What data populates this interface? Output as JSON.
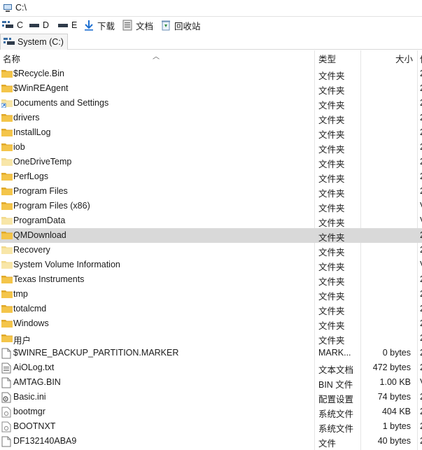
{
  "path_bar": {
    "path": "C:\\"
  },
  "drives": [
    {
      "label": "C",
      "icon": "drive-icon"
    },
    {
      "label": "D",
      "icon": "drive-icon"
    },
    {
      "label": "E",
      "icon": "drive-icon"
    },
    {
      "label": "下载",
      "icon": "download-arrow-icon"
    },
    {
      "label": "文档",
      "icon": "document-icon"
    },
    {
      "label": "回收站",
      "icon": "recycle-bin-icon"
    }
  ],
  "tab": {
    "label": "System (C:)"
  },
  "columns": {
    "name": "名称",
    "type": "类型",
    "size": "大小",
    "date": "修"
  },
  "rows": [
    {
      "name": "$Recycle.Bin",
      "type": "文件夹",
      "size": "",
      "date": "2",
      "kind": "folder"
    },
    {
      "name": "$WinREAgent",
      "type": "文件夹",
      "size": "",
      "date": "2",
      "kind": "folder"
    },
    {
      "name": "Documents and Settings",
      "type": "文件夹",
      "size": "",
      "date": "2",
      "kind": "link"
    },
    {
      "name": "drivers",
      "type": "文件夹",
      "size": "",
      "date": "2",
      "kind": "folder"
    },
    {
      "name": "InstallLog",
      "type": "文件夹",
      "size": "",
      "date": "2",
      "kind": "folder"
    },
    {
      "name": "iob",
      "type": "文件夹",
      "size": "",
      "date": "2",
      "kind": "folder"
    },
    {
      "name": "OneDriveTemp",
      "type": "文件夹",
      "size": "",
      "date": "2",
      "kind": "folder-light"
    },
    {
      "name": "PerfLogs",
      "type": "文件夹",
      "size": "",
      "date": "2",
      "kind": "folder"
    },
    {
      "name": "Program Files",
      "type": "文件夹",
      "size": "",
      "date": "2",
      "kind": "folder"
    },
    {
      "name": "Program Files (x86)",
      "type": "文件夹",
      "size": "",
      "date": "V",
      "kind": "folder"
    },
    {
      "name": "ProgramData",
      "type": "文件夹",
      "size": "",
      "date": "V",
      "kind": "folder-light"
    },
    {
      "name": "QMDownload",
      "type": "文件夹",
      "size": "",
      "date": "2",
      "kind": "folder",
      "selected": true
    },
    {
      "name": "Recovery",
      "type": "文件夹",
      "size": "",
      "date": "2",
      "kind": "folder-light"
    },
    {
      "name": "System Volume Information",
      "type": "文件夹",
      "size": "",
      "date": "V",
      "kind": "folder-light"
    },
    {
      "name": "Texas Instruments",
      "type": "文件夹",
      "size": "",
      "date": "2",
      "kind": "folder"
    },
    {
      "name": "tmp",
      "type": "文件夹",
      "size": "",
      "date": "2",
      "kind": "folder"
    },
    {
      "name": "totalcmd",
      "type": "文件夹",
      "size": "",
      "date": "2",
      "kind": "folder"
    },
    {
      "name": "Windows",
      "type": "文件夹",
      "size": "",
      "date": "2",
      "kind": "folder"
    },
    {
      "name": "用户",
      "type": "文件夹",
      "size": "",
      "date": "2",
      "kind": "folder"
    },
    {
      "name": "$WINRE_BACKUP_PARTITION.MARKER",
      "type": "MARK...",
      "size": "0 bytes",
      "date": "2",
      "kind": "file"
    },
    {
      "name": "AiOLog.txt",
      "type": "文本文档",
      "size": "472 bytes",
      "date": "2",
      "kind": "text"
    },
    {
      "name": "AMTAG.BIN",
      "type": "BIN 文件",
      "size": "1.00 KB",
      "date": "V",
      "kind": "file"
    },
    {
      "name": "Basic.ini",
      "type": "配置设置",
      "size": "74 bytes",
      "date": "2",
      "kind": "ini"
    },
    {
      "name": "bootmgr",
      "type": "系统文件",
      "size": "404 KB",
      "date": "2",
      "kind": "sys"
    },
    {
      "name": "BOOTNXT",
      "type": "系统文件",
      "size": "1 bytes",
      "date": "2",
      "kind": "sys"
    },
    {
      "name": "DF132140ABA9",
      "type": "文件",
      "size": "40 bytes",
      "date": "2",
      "kind": "file"
    }
  ],
  "colors": {
    "folder": "#f4c54a",
    "folder_dark": "#e0a92a",
    "selected_row": "#d9d9d9",
    "accent": "#1e6fd0"
  }
}
